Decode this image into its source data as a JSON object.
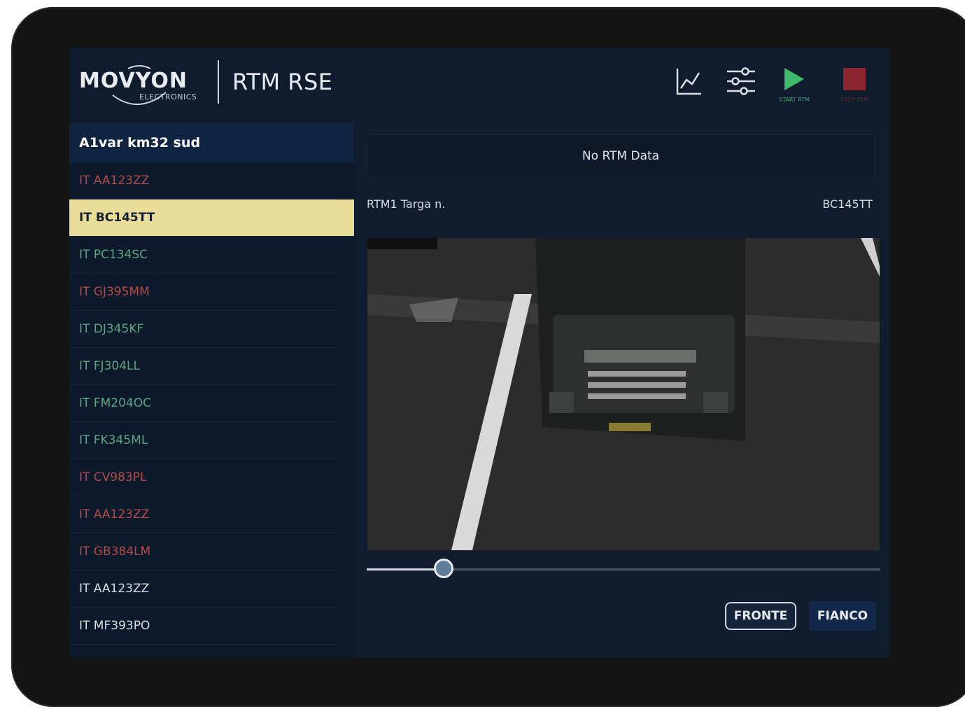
{
  "brand": {
    "logo_main": "MOVYON",
    "logo_sub": "ELECTRONICS",
    "app_title": "RTM RSE"
  },
  "toolbar": {
    "chart_icon": "chart-line-icon",
    "settings_icon": "sliders-icon",
    "start_label": "START RTM",
    "stop_label": "STOP RTM",
    "start_color": "#3dbb6b",
    "stop_color": "#8c2430"
  },
  "sidebar": {
    "site_title": "A1var km32 sud",
    "plates": [
      {
        "label": "IT AA123ZZ",
        "status": "red"
      },
      {
        "label": "IT BC145TT",
        "status": "selected"
      },
      {
        "label": "IT PC134SC",
        "status": "green"
      },
      {
        "label": "IT GJ395MM",
        "status": "red"
      },
      {
        "label": "IT DJ345KF",
        "status": "green"
      },
      {
        "label": "IT FJ304LL",
        "status": "green"
      },
      {
        "label": "IT FM204OC",
        "status": "green"
      },
      {
        "label": "IT FK345ML",
        "status": "green"
      },
      {
        "label": "IT CV983PL",
        "status": "red"
      },
      {
        "label": "IT AA123ZZ",
        "status": "red"
      },
      {
        "label": "IT GB384LM",
        "status": "red"
      },
      {
        "label": "IT AA123ZZ",
        "status": "white"
      },
      {
        "label": "IT MF393PO",
        "status": "white"
      }
    ]
  },
  "main": {
    "no_data": "No RTM Data",
    "targa_label": "RTM1 Targa n.",
    "targa_value": "BC145TT",
    "camera_view": "truck-front-camera-image",
    "slider_position_fraction": 0.15,
    "btn_fronte": "FRONTE",
    "btn_fianco": "FIANCO"
  }
}
